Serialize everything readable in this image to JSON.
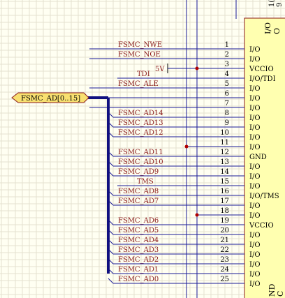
{
  "colors": {
    "background": "#FFFFF2",
    "grid": "#E4E2D0",
    "wire": "#1A1A96",
    "bus": "#101080",
    "net_label": "#8B1A1A",
    "pin_text": "#000000",
    "component_fill": "#FFFFB0",
    "component_border": "#8B1A1A",
    "port_fill": "#F8E070",
    "junction": "#B00000"
  },
  "bus_port": {
    "label": "FSMC_AD[0..15]"
  },
  "power_label": "5V",
  "top_right_text": {
    "line1": "1(",
    "line2": "9"
  },
  "component_header": {
    "col1": "I/O",
    "col2": "O"
  },
  "component_footer": {
    "col1": "ND",
    "col2": "C"
  },
  "pins": [
    {
      "number": "1",
      "net": "FSMC_NWE",
      "label": "I/O"
    },
    {
      "number": "2",
      "net": "FSMC_NOE",
      "label": "I/O"
    },
    {
      "number": "3",
      "net": "",
      "label": "VCCIO"
    },
    {
      "number": "4",
      "net": "TDI",
      "label": "I/O/TDI"
    },
    {
      "number": "5",
      "net": "FSMC_ALE",
      "label": "I/O"
    },
    {
      "number": "6",
      "net": "",
      "label": "I/O"
    },
    {
      "number": "7",
      "net": "",
      "label": "I/O"
    },
    {
      "number": "8",
      "net": "FSMC_AD14",
      "label": "I/O"
    },
    {
      "number": "9",
      "net": "FSMC_AD13",
      "label": "I/O"
    },
    {
      "number": "10",
      "net": "FSMC_AD12",
      "label": "I/O"
    },
    {
      "number": "11",
      "net": "",
      "label": "I/O"
    },
    {
      "number": "12",
      "net": "FSMC_AD11",
      "label": "GND"
    },
    {
      "number": "13",
      "net": "FSMC_AD10",
      "label": "I/O"
    },
    {
      "number": "14",
      "net": "FSMC_AD9",
      "label": "I/O"
    },
    {
      "number": "15",
      "net": "TMS",
      "label": "I/O"
    },
    {
      "number": "16",
      "net": "FSMC_AD8",
      "label": "I/O/TMS"
    },
    {
      "number": "17",
      "net": "FSMC_AD7",
      "label": "I/O"
    },
    {
      "number": "18",
      "net": "",
      "label": "I/O"
    },
    {
      "number": "19",
      "net": "FSMC_AD6",
      "label": "VCCIO"
    },
    {
      "number": "20",
      "net": "FSMC_AD5",
      "label": "I/O"
    },
    {
      "number": "21",
      "net": "FSMC_AD4",
      "label": "I/O"
    },
    {
      "number": "22",
      "net": "FSMC_AD3",
      "label": "I/O"
    },
    {
      "number": "23",
      "net": "FSMC_AD2",
      "label": "I/O"
    },
    {
      "number": "24",
      "net": "FSMC_AD1",
      "label": "I/O"
    },
    {
      "number": "25",
      "net": "FSMC_AD0",
      "label": "I/O"
    }
  ]
}
